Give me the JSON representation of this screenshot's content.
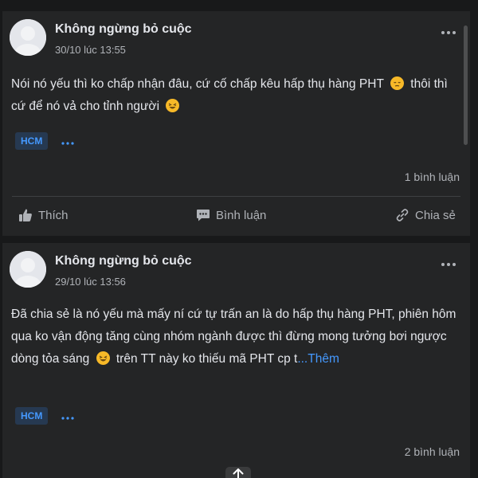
{
  "posts": [
    {
      "author": "Không ngừng bỏ cuộc",
      "time": "30/10 lúc 13:55",
      "text_parts": [
        "Nói nó yếu thì ko chấp nhận đâu, cứ cố chấp kêu hấp thụ hàng PHT ",
        " thôi thì cứ để nó vả cho tỉnh người "
      ],
      "emojis": [
        "pensive-face",
        "rolling-laughing-face"
      ],
      "tag": "HCM",
      "comment_count": "1 bình luận"
    },
    {
      "author": "Không ngừng bỏ cuộc",
      "time": "29/10 lúc 13:56",
      "text_parts": [
        "Đã chia sẻ là nó yếu mà mấy ní cứ tự trấn an là do hấp thụ hàng PHT, phiên hôm qua ko vận động tăng cùng nhóm ngành được thì đừng mong tưởng bơi ngược dòng tỏa sáng ",
        " trên TT này ko thiếu mã PHT cp t"
      ],
      "emojis": [
        "rolling-laughing-face"
      ],
      "more_label": "...Thêm",
      "tag": "HCM",
      "comment_count": "2 bình luận"
    }
  ],
  "actions": {
    "like": "Thích",
    "comment": "Bình luận",
    "share": "Chia sẻ"
  },
  "icons": [
    "avatar-placeholder-icon",
    "more-options-icon",
    "like-icon",
    "comment-icon",
    "share-link-icon",
    "arrow-up-icon"
  ],
  "colors": {
    "background": "#18191a",
    "card": "#242526",
    "text": "#e4e6eb",
    "secondary_text": "#b0b3b8",
    "link": "#4599ff",
    "tag_background": "#263951"
  }
}
